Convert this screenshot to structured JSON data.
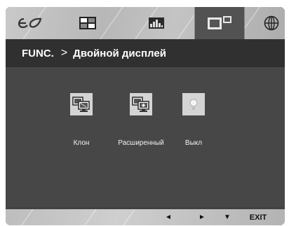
{
  "tabs": [
    {
      "name": "picture-eco-icon",
      "active": false
    },
    {
      "name": "picture-settings-icon",
      "active": false
    },
    {
      "name": "color-settings-icon",
      "active": false
    },
    {
      "name": "func-icon",
      "active": true
    },
    {
      "name": "language-globe-icon",
      "active": false
    }
  ],
  "header": {
    "section": "FUNC.",
    "separator": ">",
    "title": "Двойной дисплей"
  },
  "options": [
    {
      "label": "Клон",
      "icon": "clone-display-icon"
    },
    {
      "label": "Расширенный",
      "icon": "extended-display-icon"
    },
    {
      "label": "Выкл",
      "icon": "off-bulb-icon"
    }
  ],
  "footer": {
    "left": "◄",
    "right": "►",
    "down": "▼",
    "exit": "EXIT"
  },
  "colors": {
    "panel": "#414141",
    "header": "#303030",
    "tabbar": "#c0c0c0",
    "active_tab": "#525252",
    "option_box": "#d4d4d4"
  }
}
